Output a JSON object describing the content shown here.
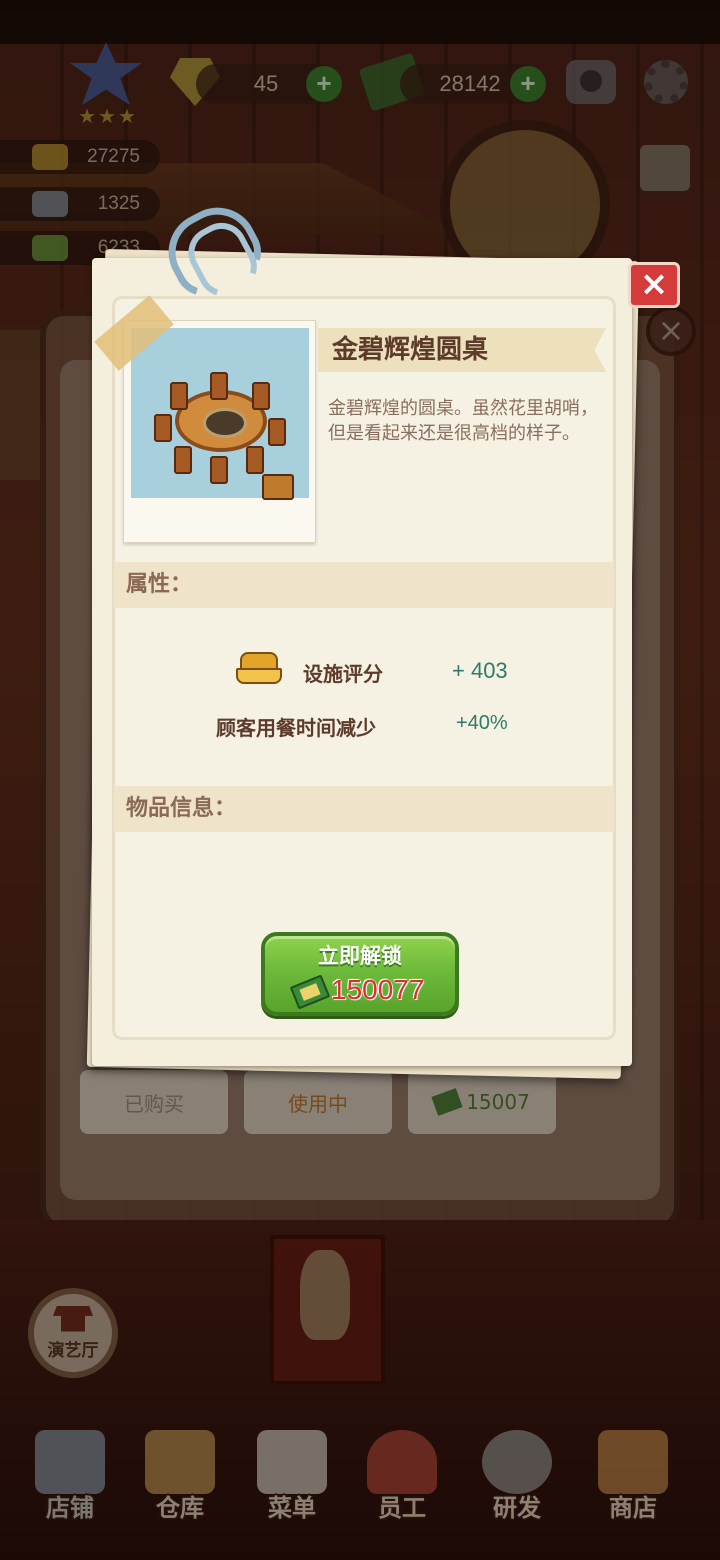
{
  "hud": {
    "gems": "45",
    "cash": "28142",
    "gem_plus": "+",
    "cash_plus": "+",
    "stats": [
      "27275",
      "1325",
      "6233"
    ]
  },
  "background": {
    "items": [
      {
        "label": "已购买"
      },
      {
        "label": "使用中"
      },
      {
        "label": "15007"
      }
    ],
    "hall_button": "演艺厅"
  },
  "nav": {
    "items": [
      "店铺",
      "仓库",
      "菜单",
      "员工",
      "研发",
      "商店"
    ]
  },
  "modal": {
    "close_label": "×",
    "title": "金碧辉煌圆桌",
    "description": "金碧辉煌的圆桌。虽然花里胡哨，但是看起来还是很高档的样子。",
    "attributes_heading": "属性：",
    "attributes": [
      {
        "label": "设施评分",
        "value": "+ 403"
      },
      {
        "label": "顾客用餐时间减少",
        "value": "+40%"
      }
    ],
    "info_heading": "物品信息：",
    "unlock_label": "立即解锁",
    "unlock_price": "150077"
  },
  "colors": {
    "accent_green": "#6bb83a",
    "close_red": "#d63b3b",
    "value_teal": "#2f7a6a",
    "price_red": "#d8322a"
  }
}
